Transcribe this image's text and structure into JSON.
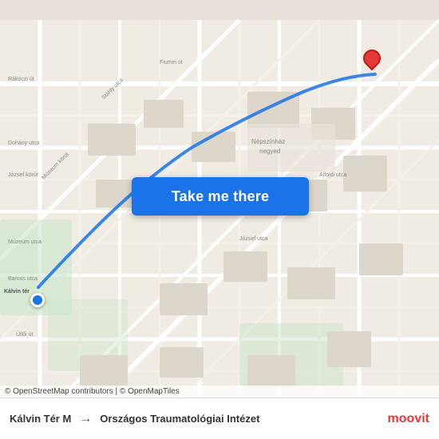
{
  "map": {
    "background_color": "#e8e0d8",
    "attribution": "© OpenStreetMap contributors | © OpenMapTiles"
  },
  "button": {
    "label": "Take me there"
  },
  "bottom_bar": {
    "origin": "Kálvin Tér M",
    "arrow": "→",
    "destination": "Országos Traumatológiai Intézet"
  },
  "logo": {
    "text": "moovit"
  },
  "pin": {
    "color": "#e53935"
  },
  "route": {
    "color": "#1a73e8",
    "opacity": "0.85"
  }
}
